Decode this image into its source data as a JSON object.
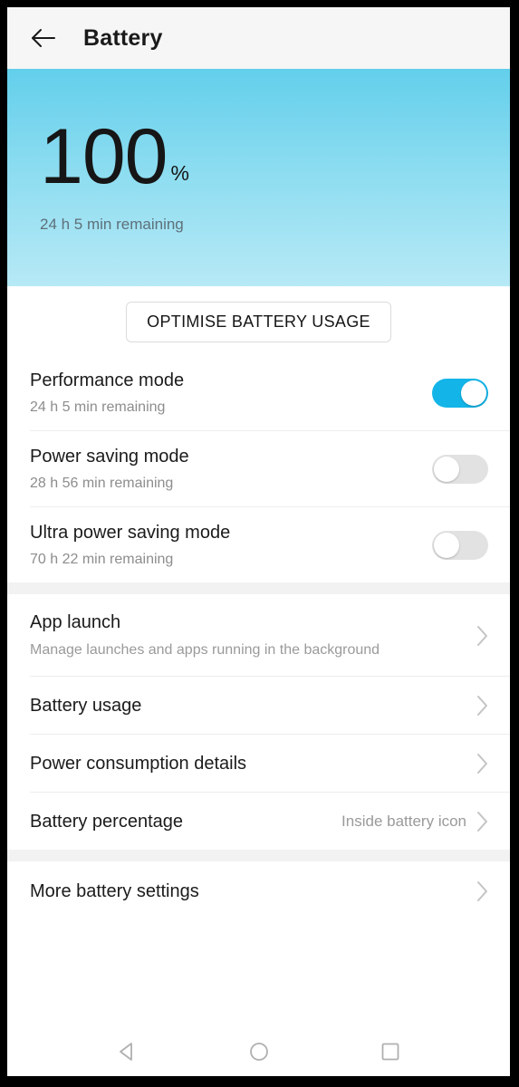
{
  "header": {
    "back_icon": "arrow-left-icon",
    "title": "Battery"
  },
  "hero": {
    "level": "100",
    "unit": "%",
    "remaining": "24 h 5 min remaining"
  },
  "optimise": {
    "label": "OPTIMISE BATTERY USAGE"
  },
  "modes": [
    {
      "title": "Performance mode",
      "subtitle": "24 h 5 min remaining",
      "state": "on"
    },
    {
      "title": "Power saving mode",
      "subtitle": "28 h 56 min remaining",
      "state": "off"
    },
    {
      "title": "Ultra power saving mode",
      "subtitle": "70 h 22 min remaining",
      "state": "off"
    }
  ],
  "settings": [
    {
      "title": "App launch",
      "subtitle": "Manage launches and apps running in the background",
      "value": "",
      "chevron": "chevron-right-icon"
    },
    {
      "title": "Battery usage",
      "subtitle": "",
      "value": "",
      "chevron": "chevron-right-icon"
    },
    {
      "title": "Power consumption details",
      "subtitle": "",
      "value": "",
      "chevron": "chevron-right-icon"
    },
    {
      "title": "Battery percentage",
      "subtitle": "",
      "value": "Inside battery icon",
      "chevron": "chevron-right-icon"
    }
  ],
  "more": {
    "title": "More battery settings",
    "chevron": "chevron-right-icon"
  },
  "navbar": {
    "back": "triangle-back-icon",
    "home": "circle-home-icon",
    "recents": "square-recents-icon"
  },
  "colors": {
    "accent": "#13b5e8",
    "hero_top": "#63cfeb",
    "hero_bottom": "#b7e9f6",
    "switch_off": "#e2e2e2",
    "appbar_bg": "#f6f6f6"
  }
}
